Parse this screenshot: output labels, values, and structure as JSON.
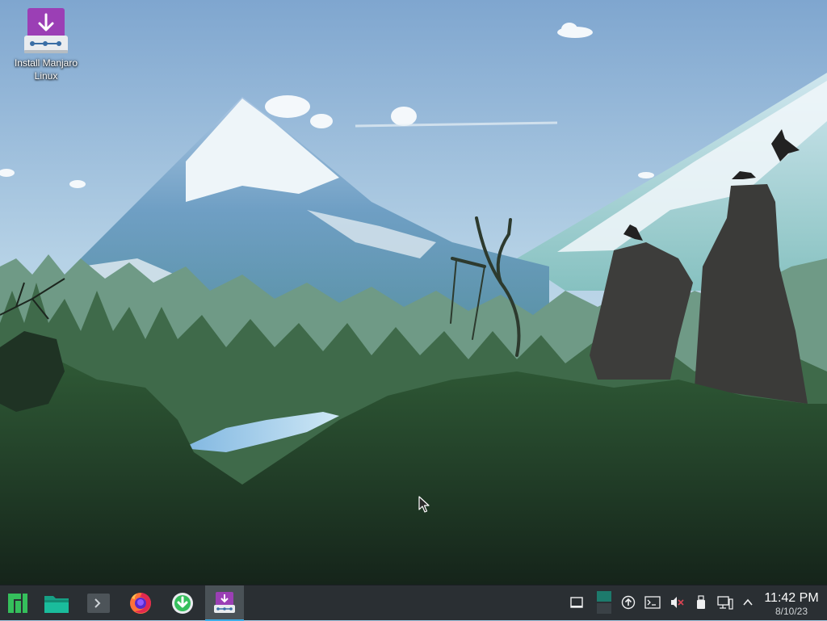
{
  "desktop": {
    "icons": [
      {
        "label": "Install Manjaro Linux",
        "icon": "installer-download-icon"
      }
    ]
  },
  "taskbar": {
    "launchers": [
      {
        "name": "application-launcher",
        "icon": "manjaro-logo-icon"
      },
      {
        "name": "file-manager",
        "icon": "folder-icon"
      },
      {
        "name": "terminal",
        "icon": "terminal-icon"
      },
      {
        "name": "firefox",
        "icon": "firefox-icon"
      },
      {
        "name": "software-update",
        "icon": "download-arrow-icon"
      },
      {
        "name": "install-manjaro",
        "icon": "installer-download-icon",
        "active": true
      }
    ],
    "tray": [
      "show-desktop-icon",
      "virtual-desktop-pager-icon",
      "update-notifier-icon",
      "terminal-dropdown-icon",
      "volume-muted-icon",
      "usb-device-icon",
      "network-wired-icon",
      "expand-tray-icon"
    ]
  },
  "clock": {
    "time": "11:42 PM",
    "date": "8/10/23"
  },
  "colors": {
    "taskbar": "#2a2f33",
    "active_task": "#4a5257",
    "highlight": "#3daee9",
    "manjaro_green": "#35bf5c",
    "installer_purple": "#9b3fb5"
  }
}
